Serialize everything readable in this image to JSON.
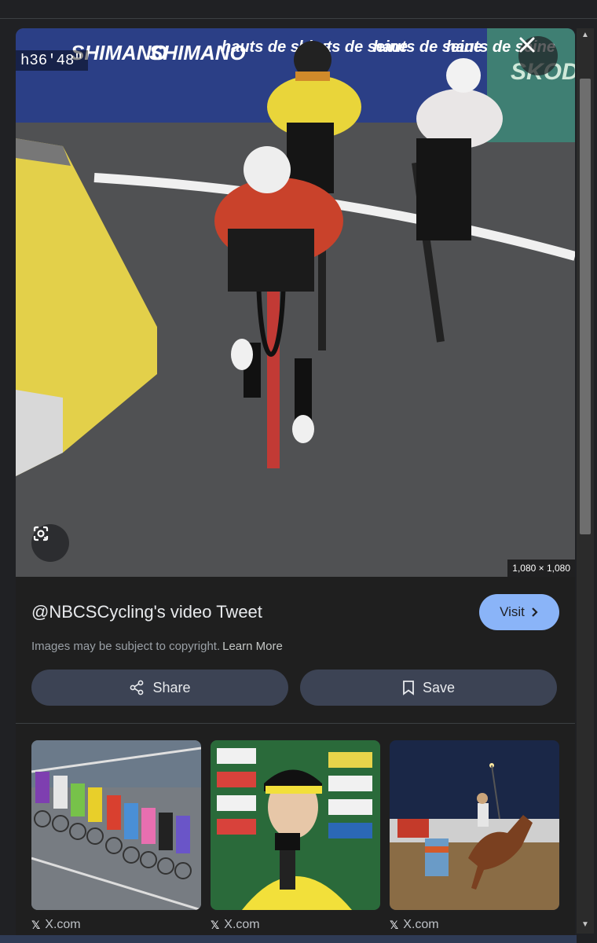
{
  "hero": {
    "timer": "h36'48\"",
    "dimensions": "1,080 × 1,080",
    "banner_texts": [
      "SHIMANO",
      "SHIMANO",
      "hauts de seine",
      "hauts de seine",
      "hauts de seine",
      "hauts de seine",
      "SKODA"
    ]
  },
  "info": {
    "title": "@NBCSCycling's video Tweet",
    "visit_label": "Visit",
    "copyright_text": "Images may be subject to copyright.",
    "learn_more": "Learn More",
    "share_label": "Share",
    "save_label": "Save"
  },
  "related": [
    {
      "source": "X.com"
    },
    {
      "source": "X.com"
    },
    {
      "source": "X.com"
    }
  ],
  "icons": {
    "close": "close-icon",
    "lens": "google-lens-icon",
    "share": "share-icon",
    "save": "bookmark-icon",
    "visit": "chevron-right-icon",
    "source": "x-logo-icon"
  },
  "colors": {
    "accent": "#8ab4f8",
    "button_bg": "#3c4354",
    "panel_bg": "#1f1f1f"
  }
}
